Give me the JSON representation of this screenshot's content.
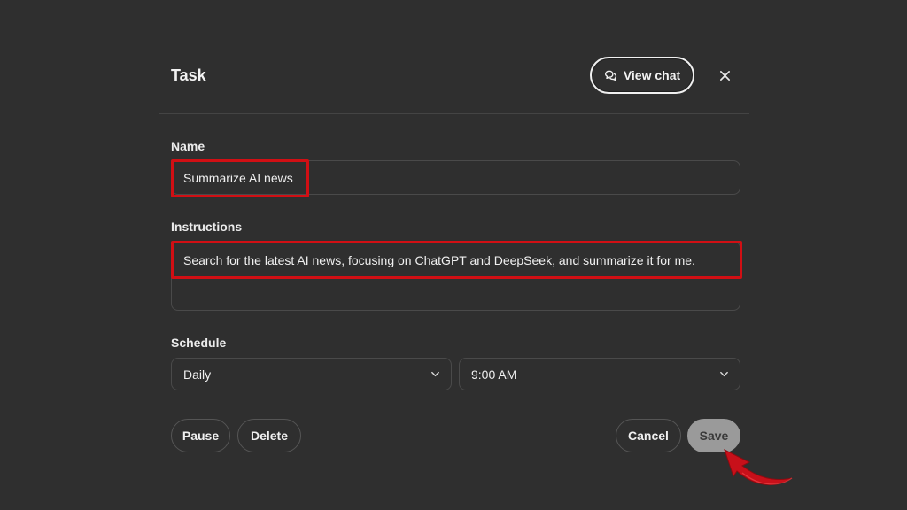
{
  "dialog": {
    "title": "Task",
    "view_chat_label": "View chat"
  },
  "form": {
    "name_label": "Name",
    "name_value": "Summarize AI news",
    "instructions_label": "Instructions",
    "instructions_value": "Search for the latest AI news, focusing on ChatGPT and DeepSeek, and summarize it for me.",
    "schedule_label": "Schedule",
    "frequency_value": "Daily",
    "time_value": "9:00 AM"
  },
  "actions": {
    "pause_label": "Pause",
    "delete_label": "Delete",
    "cancel_label": "Cancel",
    "save_label": "Save"
  },
  "icons": {
    "view_chat": "chat-bubbles-icon",
    "close": "close-icon",
    "dropdown": "chevron-down-icon"
  },
  "colors": {
    "background": "#2f2f2f",
    "highlight": "#d10f14",
    "save_disabled": "#9a9a9a"
  }
}
